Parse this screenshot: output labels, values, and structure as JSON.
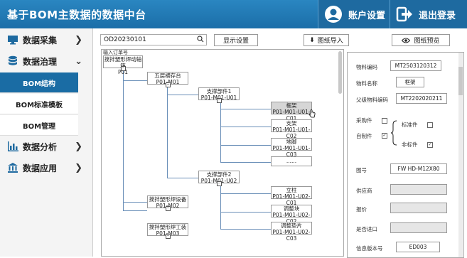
{
  "header": {
    "title": "基于BOM主数据的数据中台",
    "account_label": "账户设置",
    "logout_label": "退出登录"
  },
  "sidebar": {
    "items": [
      {
        "label": "数据采集",
        "arrow": "❯",
        "icon": "monitor-icon"
      },
      {
        "label": "数据治理",
        "arrow": "⌄",
        "icon": "database-icon"
      },
      {
        "label": "数据分析",
        "arrow": "❯",
        "icon": "bar-chart-icon"
      },
      {
        "label": "数据应用",
        "arrow": "❯",
        "icon": "institution-icon"
      }
    ],
    "sub_items": [
      {
        "label": "BOM结构"
      },
      {
        "label": "BOM标准模板"
      },
      {
        "label": "BOM管理"
      }
    ]
  },
  "toolbar": {
    "search_value": "OD20230101",
    "display_settings": "显示设置",
    "import_label": "图纸导入",
    "preview_label": "图纸预览"
  },
  "tree": {
    "input_label": "输入订单号",
    "nodes": [
      {
        "name": "搅拌塑形焊动轴箱",
        "code": "P01"
      },
      {
        "name": "五层横存台",
        "code": "P01-M01"
      },
      {
        "name": "支撑部件1",
        "code": "P01-M01-U01"
      },
      {
        "name": "框架",
        "code": "P01-M01-U01-C01"
      },
      {
        "name": "支架",
        "code": "P01-M01-U01-C02"
      },
      {
        "name": "地脚",
        "code": "P01-M01-U01-C03"
      },
      {
        "name": "......",
        "code": ""
      },
      {
        "name": "支撑部件2",
        "code": "P01-M01-U02"
      },
      {
        "name": "立柱",
        "code": "P01-M01-U02-C01"
      },
      {
        "name": "调整块",
        "code": "P01-M01-U02-C02"
      },
      {
        "name": "调整垫片",
        "code": "P01-M01-U02-C03"
      },
      {
        "name": "搅拌塑形焊设备",
        "code": "P01-M02"
      },
      {
        "name": "搅拌塑形焊工装",
        "code": "P01-M03"
      }
    ]
  },
  "properties": {
    "material_code_label": "物料编码",
    "material_code": "MT2503120312",
    "material_name_label": "物料名称",
    "material_name": "框架",
    "parent_code_label": "父级物料编码",
    "parent_code": "MT2202020211",
    "purchased_label": "采购件",
    "self_made_label": "自制件",
    "standard_label": "标准件",
    "non_standard_label": "非标件",
    "drawing_no_label": "图号",
    "drawing_no": "FW HD-M12X80",
    "supplier_label": "供应商",
    "price_label": "报价",
    "imported_label": "是否进口",
    "version_label": "信息版本号",
    "version": "ED003"
  }
}
